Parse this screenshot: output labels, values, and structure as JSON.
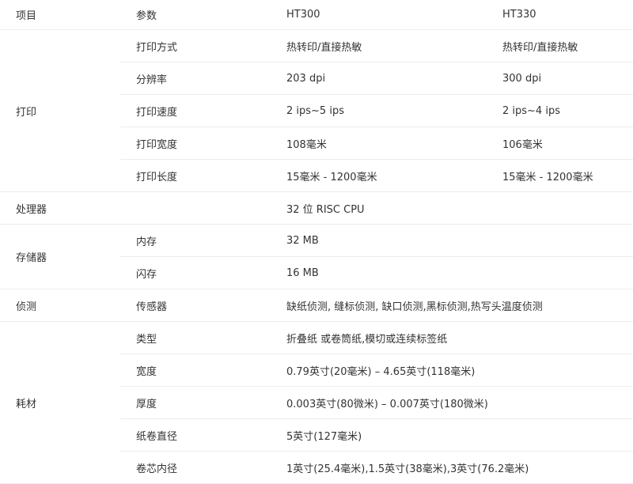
{
  "header": {
    "item": "项目",
    "param": "参数",
    "model_a": "HT300",
    "model_b": "HT330"
  },
  "print": {
    "group": "打印",
    "rows": [
      {
        "param": "打印方式",
        "a": "热转印/直接热敏",
        "b": "热转印/直接热敏"
      },
      {
        "param": "分辨率",
        "a": "203 dpi",
        "b": "300 dpi"
      },
      {
        "param": "打印速度",
        "a": "2 ips~5 ips",
        "b": "2 ips~4 ips"
      },
      {
        "param": "打印宽度",
        "a": "108毫米",
        "b": "106毫米"
      },
      {
        "param": "打印长度",
        "a": "15毫米 - 1200毫米",
        "b": "15毫米 - 1200毫米"
      }
    ]
  },
  "processor": {
    "group": "处理器",
    "value": "32 位 RISC CPU"
  },
  "storage": {
    "group": "存储器",
    "rows": [
      {
        "param": "内存",
        "value": "32 MB"
      },
      {
        "param": "闪存",
        "value": "16 MB"
      }
    ]
  },
  "sensor": {
    "group": "侦测",
    "param": "传感器",
    "value": "缺纸侦测, 缝标侦测, 缺口侦测,黑标侦测,热写头温度侦测"
  },
  "media": {
    "group": "耗材",
    "rows": [
      {
        "param": "类型",
        "value": "折叠纸 或卷筒纸,模切或连续标签纸"
      },
      {
        "param": "宽度",
        "value": "0.79英寸(20毫米) – 4.65英寸(118毫米)"
      },
      {
        "param": "厚度",
        "value": "0.003英寸(80微米) – 0.007英寸(180微米)"
      },
      {
        "param": "纸卷直径",
        "value": "5英寸(127毫米)"
      },
      {
        "param": "卷芯内径",
        "value": "1英寸(25.4毫米),1.5英寸(38毫米),3英寸(76.2毫米)"
      }
    ]
  }
}
